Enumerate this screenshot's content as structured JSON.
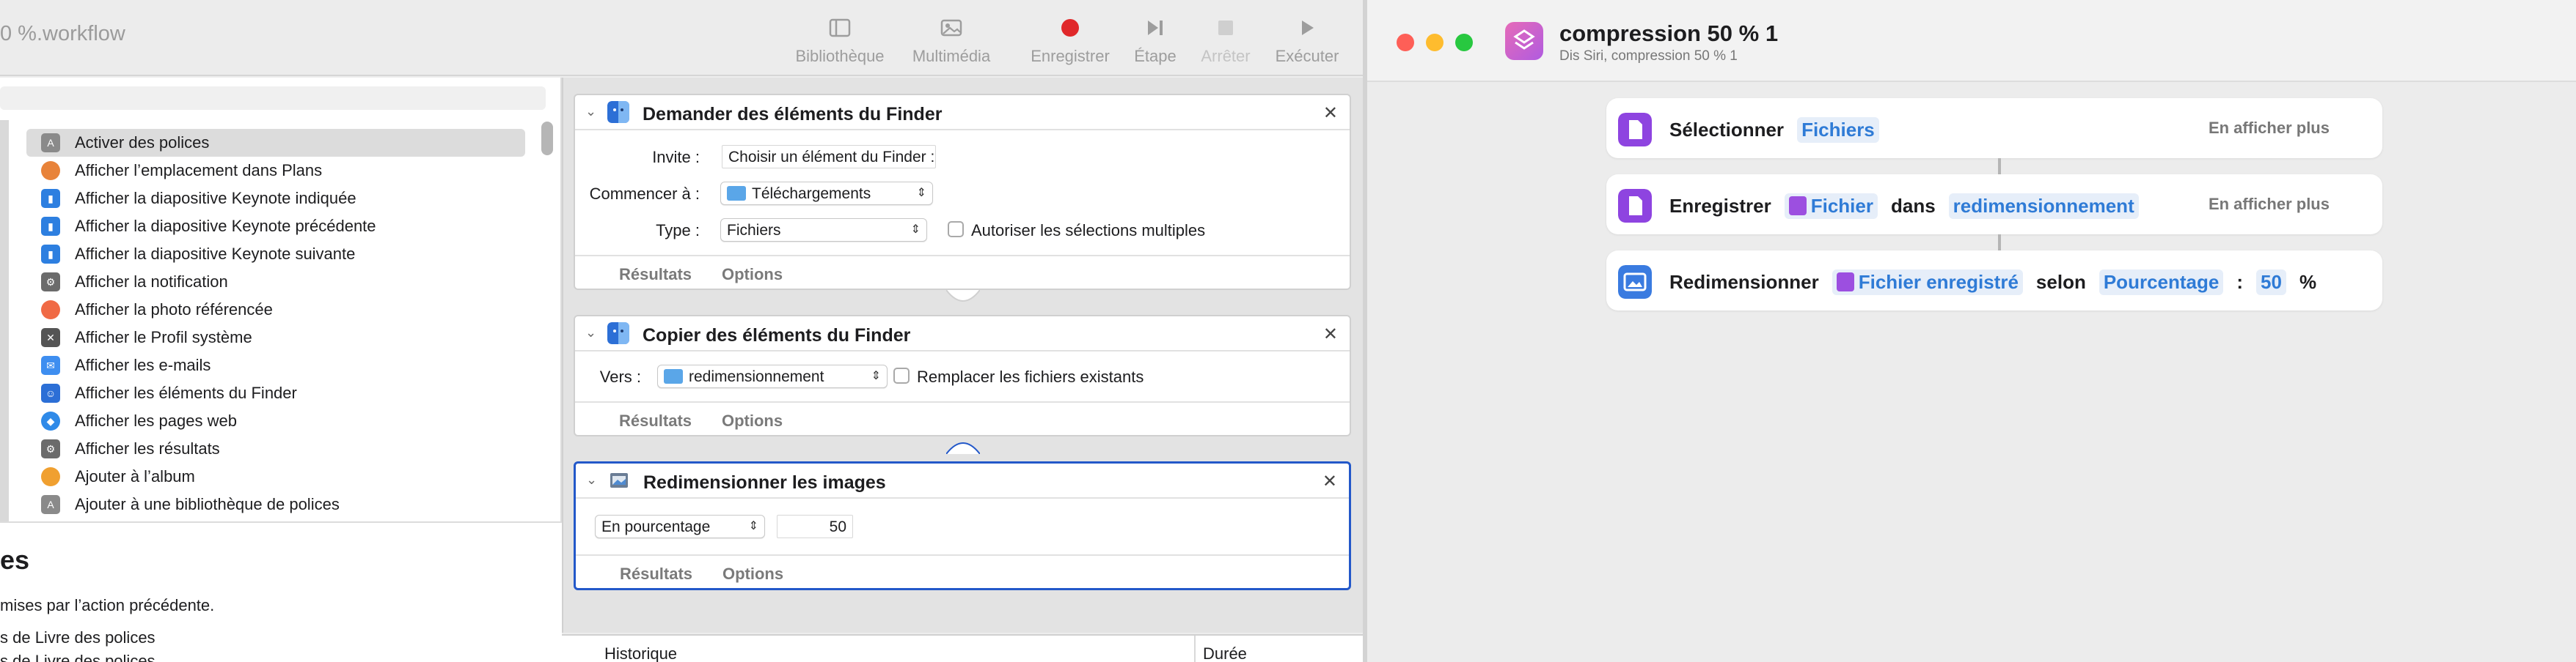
{
  "automator": {
    "window_title": "0 %.workflow",
    "toolbar": [
      {
        "label": "Bibliothèque",
        "icon": "sidebar-icon"
      },
      {
        "label": "Multimédia",
        "icon": "photo-icon"
      },
      {
        "label": "Enregistrer",
        "icon": "record-icon"
      },
      {
        "label": "Étape",
        "icon": "step-icon"
      },
      {
        "label": "Arrêter",
        "icon": "stop-icon"
      },
      {
        "label": "Exécuter",
        "icon": "play-icon"
      }
    ],
    "library_items": [
      {
        "label": "Activer des polices",
        "color": "#8a8a8a"
      },
      {
        "label": "Afficher l’emplacement dans Plans",
        "color": "#e8833a"
      },
      {
        "label": "Afficher la diapositive Keynote indiquée",
        "color": "#2d7fe0"
      },
      {
        "label": "Afficher la diapositive Keynote précédente",
        "color": "#2d7fe0"
      },
      {
        "label": "Afficher la diapositive Keynote suivante",
        "color": "#2d7fe0"
      },
      {
        "label": "Afficher la notification",
        "color": "#6b6b6b"
      },
      {
        "label": "Afficher la photo référencée",
        "color": "#f06a45"
      },
      {
        "label": "Afficher le Profil système",
        "color": "#555555"
      },
      {
        "label": "Afficher les e-mails",
        "color": "#3e8ef0"
      },
      {
        "label": "Afficher les éléments du Finder",
        "color": "#2c6fd6"
      },
      {
        "label": "Afficher les pages web",
        "color": "#2f8ae8"
      },
      {
        "label": "Afficher les résultats",
        "color": "#6b6b6b"
      },
      {
        "label": "Ajouter à l’album",
        "color": "#f0a030"
      },
      {
        "label": "Ajouter à une bibliothèque de polices",
        "color": "#8a8a8a"
      }
    ],
    "description": {
      "heading": "es",
      "text": "mises par l’action précédente.",
      "line1": "s de Livre des polices",
      "line2": "s de Livre des polices"
    },
    "actions": {
      "ask": {
        "title": "Demander des éléments du Finder",
        "prompt_label": "Invite :",
        "prompt_value": "Choisir un élément du Finder :",
        "start_label": "Commencer à :",
        "start_value": "Téléchargements",
        "type_label": "Type :",
        "type_value": "Fichiers",
        "multi_label": "Autoriser les sélections multiples",
        "results": "Résultats",
        "options": "Options"
      },
      "copy": {
        "title": "Copier des éléments du Finder",
        "to_label": "Vers :",
        "to_value": "redimensionnement",
        "replace_label": "Remplacer les fichiers existants",
        "results": "Résultats",
        "options": "Options"
      },
      "resize": {
        "title": "Redimensionner les images",
        "mode_value": "En pourcentage",
        "amount_value": "50",
        "results": "Résultats",
        "options": "Options"
      }
    },
    "log": {
      "col1": "Historique",
      "col2": "Durée"
    }
  },
  "shortcuts": {
    "title": "compression 50 % 1",
    "subtitle": "Dis Siri, compression 50 % 1",
    "actions": [
      {
        "verb": "Sélectionner",
        "token": "Fichiers",
        "more": "En afficher plus"
      },
      {
        "verb": "Enregistrer",
        "token": "Fichier",
        "word": "dans",
        "token2": "redimensionnement",
        "more": "En afficher plus"
      },
      {
        "verb": "Redimensionner",
        "token": "Fichier enregistré",
        "word": "selon",
        "token2": "Pourcentage",
        "colon": ":",
        "token3": "50",
        "unit": "%"
      }
    ],
    "colors": {
      "accent": "#2f7bd6",
      "action_purple": "#8e44e0",
      "action_blue": "#3a7be0"
    }
  }
}
